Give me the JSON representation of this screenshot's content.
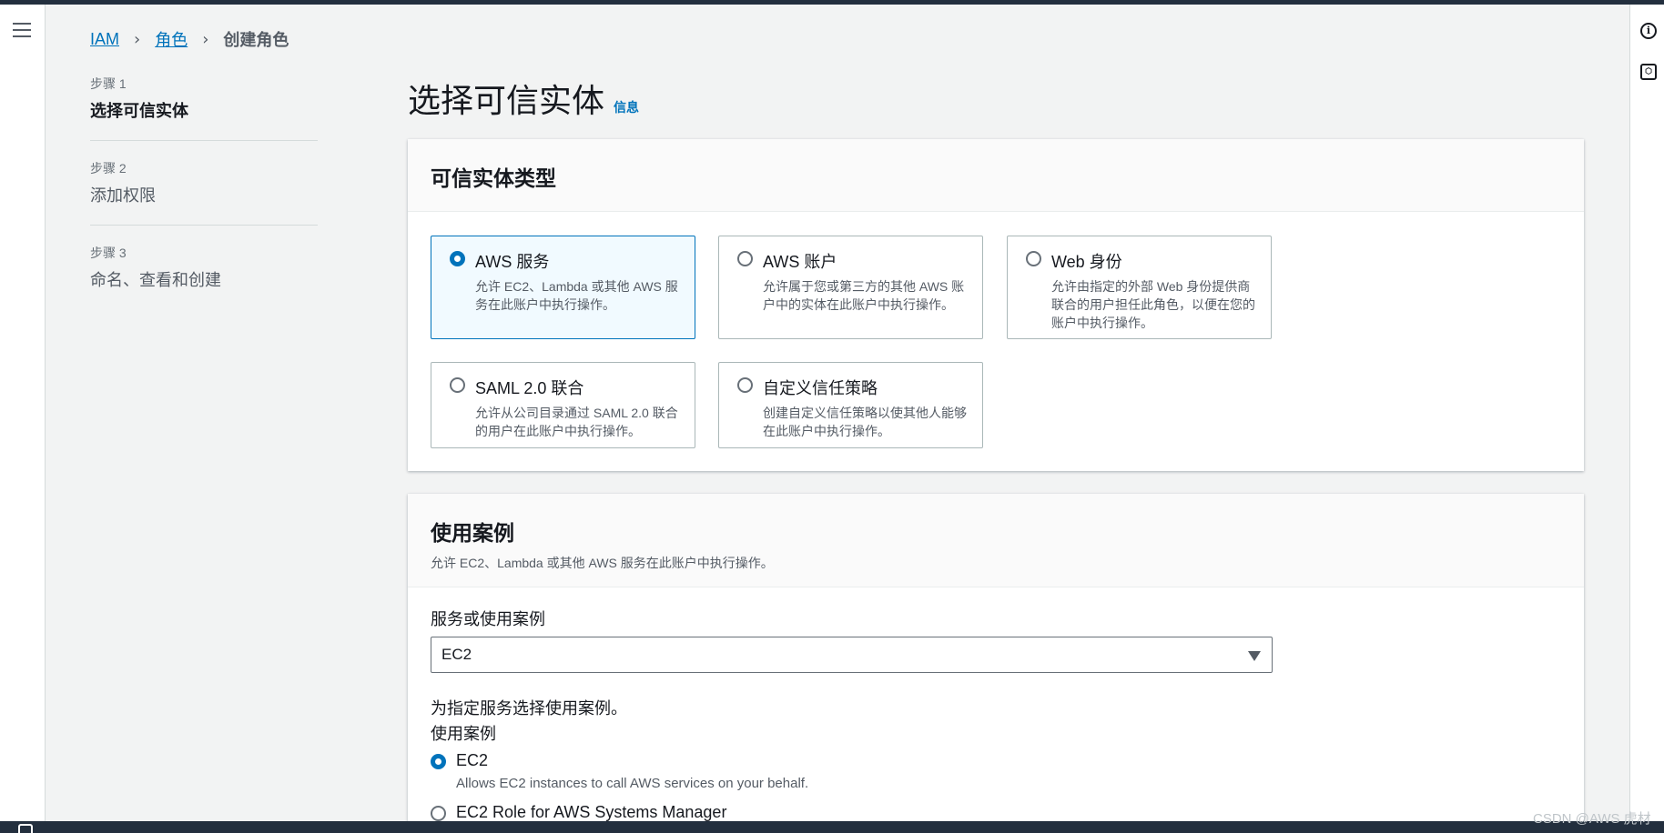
{
  "breadcrumb": {
    "items": [
      "IAM",
      "角色"
    ],
    "current": "创建角色"
  },
  "steps": [
    {
      "label": "步骤 1",
      "title": "选择可信实体"
    },
    {
      "label": "步骤 2",
      "title": "添加权限"
    },
    {
      "label": "步骤 3",
      "title": "命名、查看和创建"
    }
  ],
  "page": {
    "title": "选择可信实体",
    "info_link": "信息"
  },
  "trusted_entity": {
    "heading": "可信实体类型",
    "options": [
      {
        "title": "AWS 服务",
        "desc": "允许 EC2、Lambda 或其他 AWS 服务在此账户中执行操作。"
      },
      {
        "title": "AWS 账户",
        "desc": "允许属于您或第三方的其他 AWS 账户中的实体在此账户中执行操作。"
      },
      {
        "title": "Web 身份",
        "desc": "允许由指定的外部 Web 身份提供商联合的用户担任此角色，以便在您的账户中执行操作。"
      },
      {
        "title": "SAML 2.0 联合",
        "desc": "允许从公司目录通过 SAML 2.0 联合的用户在此账户中执行操作。"
      },
      {
        "title": "自定义信任策略",
        "desc": "创建自定义信任策略以使其他人能够在此账户中执行操作。"
      }
    ]
  },
  "use_case": {
    "heading": "使用案例",
    "desc": "允许 EC2、Lambda 或其他 AWS 服务在此账户中执行操作。",
    "service_label": "服务或使用案例",
    "service_value": "EC2",
    "choose_text": "为指定服务选择使用案例。",
    "use_case_label": "使用案例",
    "options": [
      {
        "title": "EC2",
        "desc": "Allows EC2 instances to call AWS services on your behalf."
      },
      {
        "title": "EC2 Role for AWS Systems Manager",
        "desc": ""
      }
    ]
  },
  "watermark": "CSDN @AWS 虎材"
}
